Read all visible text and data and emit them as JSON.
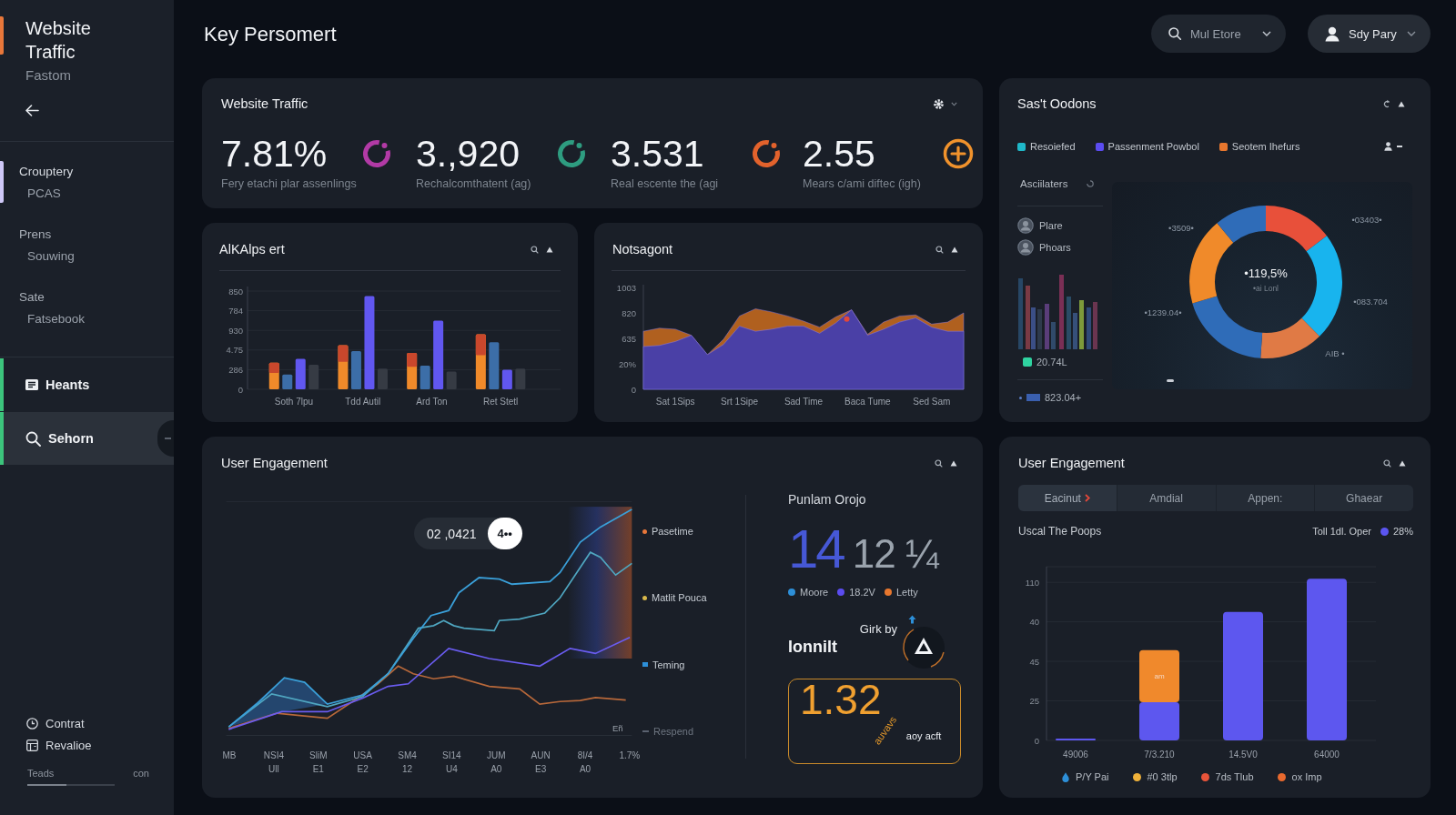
{
  "sidebar": {
    "title": "Website Traffic",
    "subtitle": "Fastom",
    "groups": [
      {
        "label": "Crouptery",
        "sub": "PCAS",
        "selected": true
      },
      {
        "label": "Prens",
        "sub": "Souwing",
        "selected": false
      },
      {
        "label": "Sate",
        "sub": "Fatsebook",
        "selected": false
      }
    ],
    "nav": [
      {
        "label": "Heants",
        "selected": false
      },
      {
        "label": "Sehorn",
        "selected": true
      }
    ],
    "links": [
      {
        "label": "Contrat"
      },
      {
        "label": "Revalioe"
      }
    ],
    "usage": {
      "label": "Teads",
      "value": "con",
      "level": 0.45
    }
  },
  "header": {
    "title": "Key Persomert",
    "filter": {
      "value": "Mul Etore"
    },
    "user": {
      "name": "Sdy Pary"
    }
  },
  "kpi_card": {
    "title": "Website Traffic",
    "metrics": [
      {
        "value": "7.81%",
        "caption": "Fery etachi plar assenlings",
        "kind": "ring",
        "color": "#b23aa6"
      },
      {
        "value": "3.,920",
        "caption": "Rechalcomthatent (ag)",
        "kind": "ring",
        "color": "#2e9c80"
      },
      {
        "value": "3.531",
        "caption": "Real escente the (agi",
        "kind": "ring",
        "color": "#e2622c"
      },
      {
        "value": "2.55",
        "caption": "Mears c/ami diftec (igh)",
        "kind": "plus",
        "color": "#f0922c"
      }
    ]
  },
  "segments_card": {
    "title": "Sas't Oodons",
    "legend": [
      {
        "label": "Resoiefed",
        "color": "#1fb8c9"
      },
      {
        "label": "Passenment Powbol",
        "color": "#5b4cf0"
      },
      {
        "label": "Seotem Ihefurs",
        "color": "#e8772e"
      }
    ],
    "side_title": "Asciilaters",
    "people": [
      {
        "name": "Plare"
      },
      {
        "name": "Phoars"
      }
    ],
    "stats": [
      {
        "value": "20.74L",
        "color": "#2fd3a0"
      },
      {
        "value": "823.04+",
        "color": "#3a5fae"
      }
    ],
    "center_value": "•119,5%",
    "center_caption": "•ai Lonl",
    "chart_data": {
      "type": "donut",
      "values": [
        14.7,
        22.9,
        13.5,
        19.4,
        18.5,
        11.0
      ],
      "colors": [
        "#e8503a",
        "#18b4ee",
        "#e07a45",
        "#2f6cb8",
        "#f08a2a",
        "#2f6cb8"
      ],
      "annotations": [
        "•3509•",
        "•03403•",
        "•1239.04•",
        "•083.704",
        "AIB •"
      ]
    }
  },
  "bar_card": {
    "title": "AlKAlps ert",
    "y_labels": [
      "850",
      "784",
      "930",
      "4.75",
      "286",
      "0"
    ],
    "x_labels": [
      "Soth 7lpu",
      "Tdd Autil",
      "Ard Ton",
      "Ret Stetl"
    ]
  },
  "area_card": {
    "title": "Notsagont",
    "y_labels": [
      "1003",
      "820",
      "635",
      "20%",
      "0"
    ],
    "x_labels": [
      "Sat 1Sips",
      "Srt 1Sipe",
      "Sad Time",
      "Baca Tume",
      "Sed Sam"
    ]
  },
  "engagement_card": {
    "title": "User Engagement",
    "tooltip": {
      "value": "02 ,0421",
      "badge": "4••"
    },
    "end_label": "Eñ",
    "x_labels": [
      "MB",
      "NSI4 Ull",
      "SliM E1",
      "USA E2",
      "SM4 12",
      "SI14 U4",
      "JUM A0",
      "AUN E3",
      "8I/4 A0",
      "1.7%"
    ],
    "legend": [
      {
        "label": "Pasetime",
        "color": "#e8773a",
        "kind": "dot"
      },
      {
        "label": "Matlit Pouca",
        "color": "#d9b84a",
        "kind": "dot"
      },
      {
        "label": "Teming",
        "color": "#2d8fd8",
        "kind": "square"
      },
      {
        "label": "Respend",
        "color": "#5a6270",
        "kind": "dash"
      }
    ],
    "stat": {
      "title": "Punlam Orojo",
      "primary": "14",
      "secondary": "12 ¼",
      "legend": [
        {
          "label": "Moore",
          "color": "#2d8fd8"
        },
        {
          "label": "18.2V",
          "color": "#5b4cf0"
        },
        {
          "label": "Letty",
          "color": "#e8772e"
        }
      ]
    },
    "promo": {
      "title": "Girk by",
      "brand": "Ionnilt",
      "value": "1.32",
      "tag": "auvavs",
      "caption": "aoy acft"
    }
  },
  "breakdown_card": {
    "title": "User Engagement",
    "tabs": [
      {
        "label": "Eacinut",
        "selected": true
      },
      {
        "label": "Amdial",
        "selected": false
      },
      {
        "label": "Appen:",
        "selected": false
      },
      {
        "label": "Ghaear",
        "selected": false
      }
    ],
    "subtitle": "Uscal The Poops",
    "summary": {
      "label": "Toll 1dl. Oper",
      "value": "28%",
      "color": "#5b55f0"
    },
    "y_labels": [
      "110",
      "40",
      "45",
      "25",
      "0"
    ],
    "x_labels": [
      "49006",
      "7/3.210",
      "14.5V0",
      "64000"
    ],
    "bar_label": "am",
    "legend": [
      {
        "label": "P/Y Pai",
        "color": "#2d8fd8",
        "kind": "drop"
      },
      {
        "label": "#0 3tlp",
        "color": "#f0b23a",
        "kind": "dot"
      },
      {
        "label": "7ds Tlub",
        "color": "#e8543a",
        "kind": "dot"
      },
      {
        "label": "ox Imp",
        "color": "#e8692e",
        "kind": "dot"
      }
    ]
  }
}
